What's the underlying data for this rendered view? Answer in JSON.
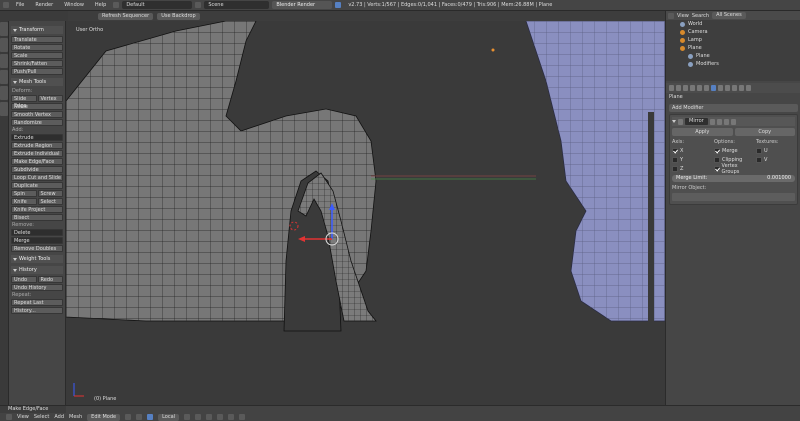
{
  "menu": {
    "file": "File",
    "render": "Render",
    "window": "Window",
    "help": "Help"
  },
  "layout": "Default",
  "scene": "Scene",
  "engine": "Blender Render",
  "stats": "v2.73 | Verts:1/567 | Edges:0/1,041 | Faces:0/479 | Tris:906 | Mem:26.88M | Plane",
  "header2": {
    "refresh": "Refresh Sequencer",
    "backdrop": "Use Backdrop"
  },
  "toolshelf": {
    "transform_header": "Transform",
    "transform": [
      "Translate",
      "Rotate",
      "Scale",
      "Shrink/Fatten",
      "Push/Pull"
    ],
    "mesh_header": "Mesh Tools",
    "deform_label": "Deform:",
    "slide_edge": "Slide Edge",
    "vertex": "Vertex",
    "deform_rest": [
      "Noise",
      "Smooth Vertex",
      "Randomize"
    ],
    "add_label": "Add:",
    "extrude": "Extrude",
    "add_rest": [
      "Extrude Region",
      "Extrude Individual",
      "Make Edge/Face",
      "Subdivide",
      "Loop Cut and Slide",
      "Duplicate"
    ],
    "spin": "Spin",
    "screw": "Screw",
    "knife": "Knife",
    "select": "Select",
    "knife_project": "Knife Project",
    "bisect": "Bisect",
    "remove_label": "Remove:",
    "delete": "Delete",
    "merge": "Merge",
    "remove_doubles": "Remove Doubles",
    "weight_header": "Weight Tools",
    "history_header": "History",
    "undo": "Undo",
    "redo": "Redo",
    "undo_history": "Undo History",
    "repeat_label": "Repeat:",
    "repeat_last": "Repeat Last",
    "history": "History..."
  },
  "viewport": {
    "label": "User Ortho",
    "object": "(0) Plane"
  },
  "bottom": {
    "panel": "Make Edge/Face",
    "view": "View",
    "select": "Select",
    "add": "Add",
    "mesh": "Mesh",
    "mode": "Edit Mode",
    "pivot": "Local"
  },
  "outliner": {
    "view": "View",
    "search": "Search",
    "filter": "All Scenes",
    "items": [
      "World",
      "Camera",
      "Lamp",
      "Plane",
      "Plane",
      "Modifiers"
    ]
  },
  "props": {
    "object": "Plane",
    "add_modifier": "Add Modifier",
    "mod_name": "Mirror",
    "apply": "Apply",
    "copy": "Copy",
    "axis": "Axis:",
    "options": "Options:",
    "textures": "Textures:",
    "x": "X",
    "y": "Y",
    "z": "Z",
    "merge": "Merge",
    "clipping": "Clipping",
    "vertex_groups": "Vertex Groups",
    "u": "U",
    "v": "V",
    "merge_limit": "Merge Limit:",
    "merge_value": "0.001000",
    "mirror_object": "Mirror Object:"
  },
  "colors": {
    "accent": "#5680c2",
    "selected": "#d88a2b",
    "mesh_right": "#8a8fc0"
  }
}
